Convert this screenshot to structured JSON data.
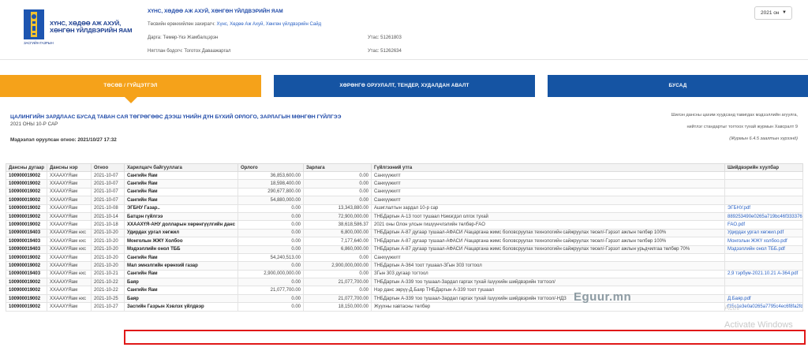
{
  "header": {
    "logo_text": "ХҮНС, ХӨДӨӨ АЖ АХУЙ, ХӨНГӨН ҮЙЛДВЭРИЙН ЯАМ",
    "logo_sub": "ЗАСГИЙН ГАЗРЫН",
    "title": "ХҮНС, ХӨДӨӨ АЖ АХУЙ, ХӨНГӨН ҮЙЛДВЭРИЙН ЯАМ",
    "manager_label": "Төсвийн ерөнхийлөн захирагч:",
    "manager_value": "Хүнс, Хөдөө Аж Ахуй, Хөнгөн үйлдвэрийн Сайд",
    "director": "Дарга: Төмөр-Үкэ Жамбалцэрэн",
    "accountant": "Нягтлан бодогч: Тоготох Даваажаргал",
    "phone1": "Утас: 51261803",
    "phone2": "Утас: 51262634",
    "year_select": "2021 он"
  },
  "tabs": [
    {
      "label": "ТӨСӨВ / ГҮЙЦЭТГЭЛ"
    },
    {
      "label": "ХӨРӨНГӨ ОРУУЛАЛТ, ТЕНДЕР, ХУДАЛДАН АВАЛТ"
    },
    {
      "label": "БУСАД"
    }
  ],
  "report": {
    "title": "ЦАЛИНГИЙН ЗАРДЛААС БУСАД ТАВАН САЯ ТӨГРӨГӨӨС ДЭЭШ ҮНИЙН ДҮН БҮХИЙ ОРЛОГО, ЗАРЛАГЫН МӨНГӨН ГҮЙЛГЭЭ",
    "subtitle": "2021 ОНЫ 10-Р САР",
    "date": "Мэдээлэл оруулсан огноо: 2021/10/27 17:32",
    "note1": "Шилэн дансны цахим хуудсанд тавигдах мэдээллийн агуулга,",
    "note2": "нийтлэг стандартыг тогтоох тухай журмын Хавсралт 9",
    "note3": "(Журмын 6.4.5 заалтын хүрээнд)"
  },
  "table": {
    "headers": [
      "Дансны дугаар",
      "Дансны нэр",
      "Огноо",
      "Харилцагч байгууллага",
      "Орлого",
      "Зарлага",
      "Гүйлгээний утга",
      "Шийдвэрийн хуулбар"
    ],
    "rows": [
      [
        "100900019002",
        "ХХААХҮЯам",
        "2021-10-07",
        "Сангийн Яам",
        "36,853,600.00",
        "0.00",
        "Санхүүжилт",
        ""
      ],
      [
        "100900019002",
        "ХХААХҮЯам",
        "2021-10-07",
        "Сангийн Яам",
        "18,598,400.00",
        "0.00",
        "Санхүүжилт",
        ""
      ],
      [
        "100900019002",
        "ХХААХҮЯам",
        "2021-10-07",
        "Сангийн Яам",
        "290,677,800.00",
        "0.00",
        "Санхүүжилт",
        ""
      ],
      [
        "100900019002",
        "ХХААХҮЯам",
        "2021-10-07",
        "Сангийн Яам",
        "54,880,000.00",
        "0.00",
        "Санхүүжилт",
        ""
      ],
      [
        "100900019002",
        "ХХААХҮЯам",
        "2021-10-08",
        "ЭГБНУ Газар..",
        "0.00",
        "13,343,880.00",
        "Ашиглалтын зардал 10-р сар",
        "ЭГБНУ.pdf"
      ],
      [
        "100900019002",
        "ХХААХҮЯам",
        "2021-10-14",
        "Батцэн гүйлгээ",
        "0.00",
        "72,900,000.00",
        "ТНБДаргын А-13 тоот тушаал Нэмэгдэл олгох тухай",
        "889253490e0265a719bc46f333376bb8.pdf"
      ],
      [
        "100900019002",
        "ХХААХҮЯам",
        "2021-10-18",
        "ХХААХҮЯ-АНУ долларын хөрөнгүүлгийн данс",
        "0.00",
        "38,618,586.37",
        "2021 оны Олон улсын гишүүнчлэлийн төлбөр-FAO",
        "FAO.pdf"
      ],
      [
        "100900019403",
        "ХХААХҮЯам нхс",
        "2021-10-20",
        "Удирдах ургал хөгжил",
        "0.00",
        "6,800,000.00",
        "ТНБДаргын А-87 дугаар тушаал-АФАСИ /Чацаргана жимс боловсруулах технологийн сайжруулах төсөл/-Гэрээт ажлын төлбөр 100%",
        "Удирдах ургал хөгжил.pdf"
      ],
      [
        "100900019403",
        "ХХААХҮЯам нхс",
        "2021-10-20",
        "Монголын ЖЖҮ Холбоо",
        "0.00",
        "7,177,640.00",
        "ТНБДаргын А-87 дугаар тушаал-АФАСИ /Чацаргана жимс боловсруулах технологийн сайжруулах төсөл/-Гэрээт ажлын төлбөр 100%",
        "Монголын ЖЖҮ холбоо.pdf"
      ],
      [
        "100900019403",
        "ХХААХҮЯам нхс",
        "2021-10-20",
        "Мэдээллийн онол ТББ",
        "0.00",
        "6,860,000.00",
        "ТНБДаргын А-87 дугаар тушаал-АФАСИ /Чацаргана жимс боловсруулах технологийн сайжруулах төсөл/-Гэрээт ажлын урьдчилгаа төлбөр 70%",
        "Мэдээллийн онол ТББ.pdf"
      ],
      [
        "100900019002",
        "ХХААХҮЯам",
        "2021-10-20",
        "Сангийн Яам",
        "54,240,513.00",
        "0.00",
        "Санхүүжилт",
        ""
      ],
      [
        "100900019002",
        "ХХААХҮЯам",
        "2021-10-20",
        "Мал эмнэлгийн ерөнхий газар",
        "0.00",
        "2,900,000,000.00",
        "ТНБДаргын А-364 тоот тушаал-ЗГын 303 тогтоол",
        ""
      ],
      [
        "100900019403",
        "ХХААХҮЯам нхс",
        "2021-10-21",
        "Сангийн Яам",
        "2,900,000,000.00",
        "0.00",
        "ЗГын 303 дугаар тогтоол",
        "2,9 тэрбум-2021.10.21 А-364.pdf"
      ],
      [
        "100900019002",
        "ХХААХҮЯам",
        "2021-10-22",
        "Баяр",
        "0.00",
        "21,077,700.00",
        "ТНБДаргын А-339 тоо тушаал-Зардал гаргах тухай /шүүхийн шийдвэрийн тогтоол/",
        ""
      ],
      [
        "100900019002",
        "ХХААХҮЯам",
        "2021-10-22",
        "Сангийн Яам",
        "21,077,700.00",
        "0.00",
        "Нэр данс зөрүү-Д.Баяр ТНБДаргын А-339 тоот тушаал",
        ""
      ],
      [
        "100900019002",
        "ХХААХҮЯам нхс",
        "2021-10-25",
        "Баяр",
        "0.00",
        "21,077,700.00",
        "ТНБДаргын А-339 тоо тушаал-Зардал гаргах тухай /шүүхийн шийдвэрийн тогтоол/-НДЗ",
        "Д.Баяр.pdf"
      ],
      [
        "100900019002",
        "ХХААХҮЯам",
        "2021-10-27",
        "Засгийн Газрын Хэвлэх үйлдвэр",
        "0.00",
        "18,150,000.00",
        "Жуухны хавтасны төлбөр",
        "f15c1e3e0a0265a7795c4ec6f8fa2fde (1).pdf"
      ]
    ]
  },
  "watermark": "Eguur.mn",
  "windows_watermark": "Activate Windows",
  "windows_watermark_short": "Activ"
}
